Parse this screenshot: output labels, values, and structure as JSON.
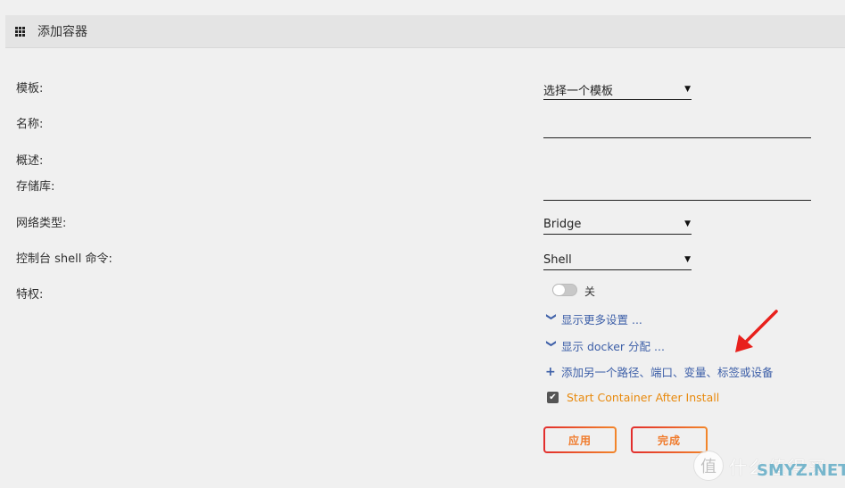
{
  "header": {
    "icon": "grid-icon",
    "title": "添加容器"
  },
  "form": {
    "labels": {
      "template": "模板:",
      "name": "名称:",
      "description": "概述:",
      "repository": "存储库:",
      "network_type": "网络类型:",
      "console_shell": "控制台 shell 命令:",
      "privileged": "特权:"
    },
    "template_select": {
      "value": "选择一个模板",
      "icon": "caret-down-icon"
    },
    "name_input": {
      "value": "",
      "placeholder": ""
    },
    "repository_input": {
      "value": "",
      "placeholder": ""
    },
    "network_select": {
      "value": "Bridge",
      "icon": "caret-down-icon"
    },
    "shell_select": {
      "value": "Shell",
      "icon": "caret-down-icon"
    },
    "privileged_toggle": {
      "state": "off",
      "label": "关"
    }
  },
  "links": {
    "more_settings": {
      "icon": "chevron-down-icon",
      "label": "显示更多设置 ..."
    },
    "docker_allocation": {
      "icon": "chevron-down-icon",
      "label": "显示 docker 分配 ..."
    },
    "add_another": {
      "icon": "plus-icon",
      "label": "添加另一个路径、端口、变量、标签或设备"
    }
  },
  "start_after_install": {
    "checked": true,
    "label": "Start Container After Install"
  },
  "buttons": {
    "apply": "应用",
    "done": "完成"
  },
  "watermark": {
    "logo": "值",
    "text": "什么值得买",
    "site": "SMYZ.NET"
  },
  "colors": {
    "accent_orange": "#e8890c",
    "link_blue": "#3d5fa8",
    "button_red": "#e22d2d",
    "annotation_arrow": "#e8201c"
  }
}
